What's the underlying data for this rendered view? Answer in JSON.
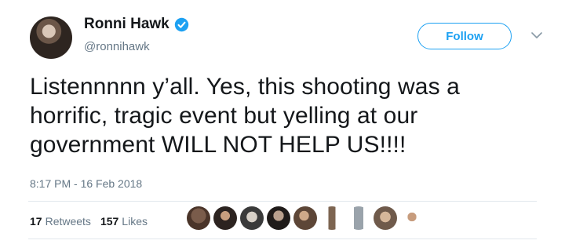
{
  "user": {
    "display_name": "Ronni Hawk",
    "handle": "@ronnihawk",
    "verified": true
  },
  "follow_button": {
    "label": "Follow"
  },
  "tweet": {
    "text": "Listennnnn y’all. Yes, this shooting was a horrific, tragic event but yelling at our government WILL NOT HELP US!!!!",
    "timestamp": "8:17 PM - 16 Feb 2018"
  },
  "stats": {
    "retweets_count": "17",
    "retweets_label": "Retweets",
    "likes_count": "157",
    "likes_label": "Likes"
  },
  "colors": {
    "accent": "#1da1f2",
    "secondary_text": "#657786",
    "divider": "#e1e8ed"
  }
}
